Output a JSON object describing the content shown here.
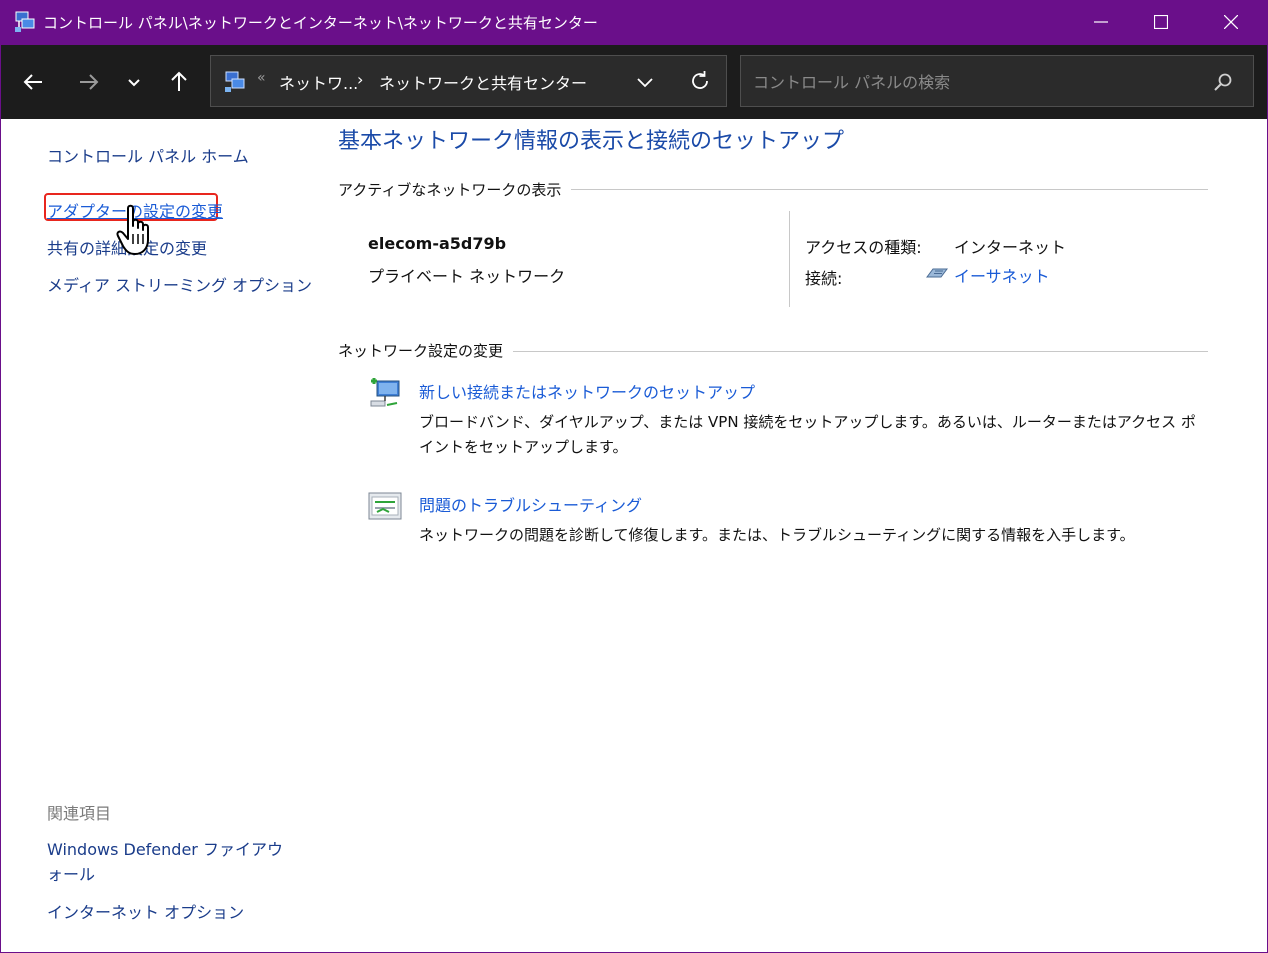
{
  "window": {
    "title": "コントロール パネル\\ネットワークとインターネット\\ネットワークと共有センター"
  },
  "nav": {
    "overflow": "«",
    "breadcrumb_1": "ネットワ...",
    "separator": "›",
    "breadcrumb_2": "ネットワークと共有センター",
    "search_placeholder": "コントロール パネルの検索"
  },
  "sidebar": {
    "home": "コントロール パネル ホーム",
    "adapter": "アダプターの設定の変更",
    "sharing": "共有の詳細設定の変更",
    "media": "メディア ストリーミング オプション",
    "related_heading": "関連項目",
    "defender": "Windows Defender ファイアウォール",
    "internet_options": "インターネット オプション"
  },
  "main": {
    "title": "基本ネットワーク情報の表示と接続のセットアップ",
    "active_heading": "アクティブなネットワークの表示",
    "network_name": "elecom-a5d79b",
    "network_type": "プライベート ネットワーク",
    "access_type_label": "アクセスの種類:",
    "access_type_value": "インターネット",
    "connection_label": "接続:",
    "connection_value": "イーサネット",
    "change_heading": "ネットワーク設定の変更",
    "task1_title": "新しい接続またはネットワークのセットアップ",
    "task1_desc": "ブロードバンド、ダイヤルアップ、または VPN 接続をセットアップします。あるいは、ルーターまたはアクセス ポイントをセットアップします。",
    "task2_title": "問題のトラブルシューティング",
    "task2_desc": "ネットワークの問題を診断して修復します。または、トラブルシューティングに関する情報を入手します。"
  },
  "colors": {
    "titlebar": "#6a0f8a",
    "navbar": "#1c1c1c",
    "link": "#1a5bd6",
    "highlight": "#e8261e"
  },
  "icons": [
    "network-center-icon",
    "minimize-icon",
    "maximize-icon",
    "close-icon",
    "back-icon",
    "forward-icon",
    "recent-locations-icon",
    "up-icon",
    "chevron-down-icon",
    "refresh-icon",
    "search-icon",
    "ethernet-icon",
    "new-connection-icon",
    "troubleshoot-icon",
    "hand-cursor-icon"
  ]
}
